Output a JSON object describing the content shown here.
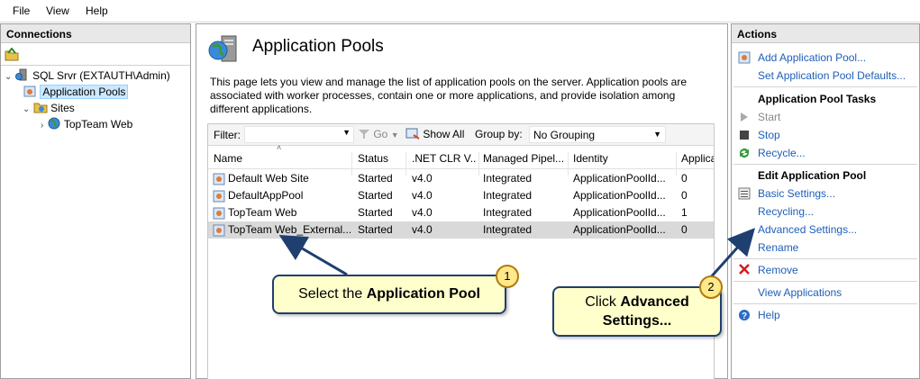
{
  "menu": {
    "file": "File",
    "view": "View",
    "help": "Help"
  },
  "connections": {
    "header": "Connections",
    "tree": {
      "server": "SQL Srvr (EXTAUTH\\Admin)",
      "app_pools": "Application Pools",
      "sites": "Sites",
      "site1": "TopTeam Web"
    }
  },
  "center": {
    "title": "Application Pools",
    "description": "This page lets you view and manage the list of application pools on the server. Application pools are associated with worker processes, contain one or more applications, and provide isolation among different applications.",
    "filter_label": "Filter:",
    "go_label": "Go",
    "show_all_label": "Show All",
    "group_by_label": "Group by:",
    "group_by_value": "No Grouping",
    "columns": [
      "Name",
      "Status",
      ".NET CLR V...",
      "Managed Pipel...",
      "Identity",
      "Applica"
    ],
    "rows": [
      [
        "Default Web Site",
        "Started",
        "v4.0",
        "Integrated",
        "ApplicationPoolId...",
        "0"
      ],
      [
        "DefaultAppPool",
        "Started",
        "v4.0",
        "Integrated",
        "ApplicationPoolId...",
        "0"
      ],
      [
        "TopTeam Web",
        "Started",
        "v4.0",
        "Integrated",
        "ApplicationPoolId...",
        "1"
      ],
      [
        "TopTeam Web_External...",
        "Started",
        "v4.0",
        "Integrated",
        "ApplicationPoolId...",
        "0"
      ]
    ],
    "selected_row": 3
  },
  "actions": {
    "header": "Actions",
    "add_pool": "Add Application Pool...",
    "set_defaults": "Set Application Pool Defaults...",
    "tasks_header": "Application Pool Tasks",
    "start": "Start",
    "stop": "Stop",
    "recycle": "Recycle...",
    "edit_header": "Edit Application Pool",
    "basic_settings": "Basic Settings...",
    "recycling": "Recycling...",
    "advanced_settings": "Advanced Settings...",
    "rename": "Rename",
    "remove": "Remove",
    "view_apps": "View Applications",
    "help": "Help"
  },
  "callouts": {
    "one_number": "1",
    "one_prefix": "Select the ",
    "one_bold": "Application Pool",
    "two_number": "2",
    "two_prefix": "Click ",
    "two_bold1": "Advanced",
    "two_bold2": "Settings..."
  },
  "colors": {
    "link": "#1e5fb8",
    "callout_bg": "#ffffcc",
    "callout_border": "#1f3f6f",
    "selected_row": "#d9d9d9"
  }
}
